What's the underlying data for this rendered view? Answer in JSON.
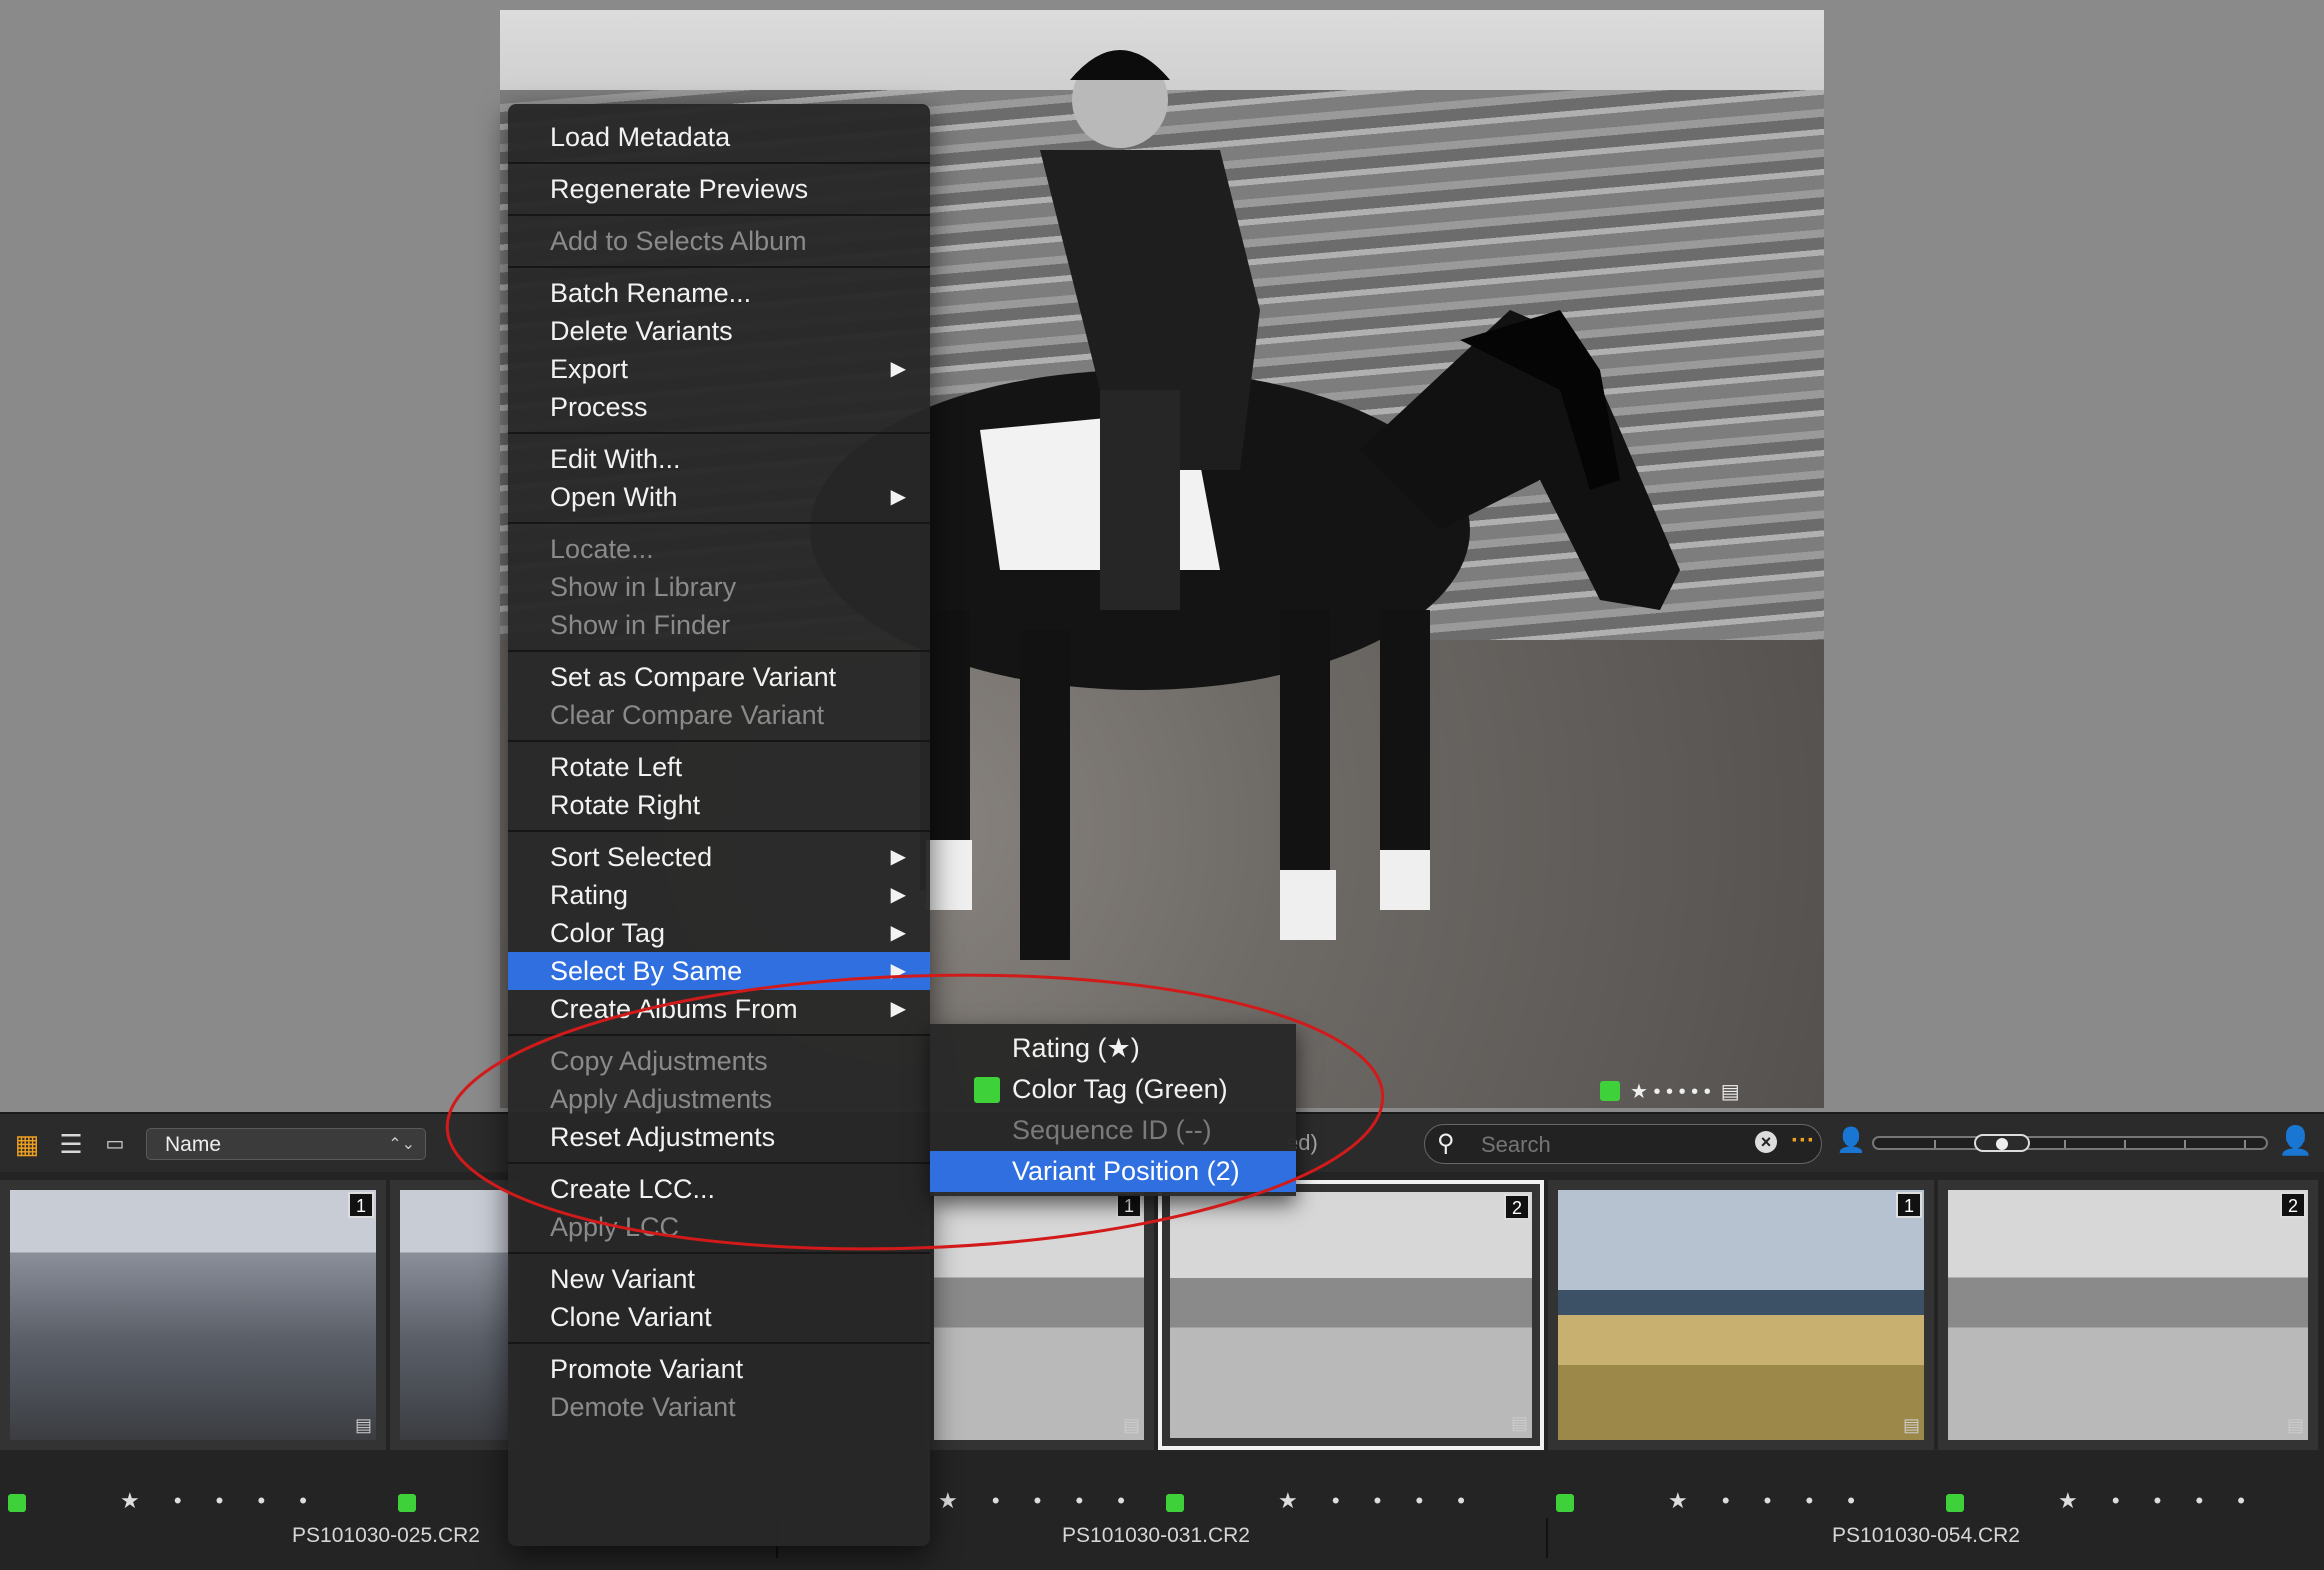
{
  "colors": {
    "accent": "#2f6fe0",
    "green_tag": "#3fd13a",
    "annotation": "#d21a1a"
  },
  "toolbar": {
    "sort_value": "Name",
    "hidden_text": "ed)",
    "search_placeholder": "Search",
    "icons": [
      "grid-view-icon",
      "list-view-icon",
      "filmstrip-view-icon",
      "sort-chevron-icon",
      "search-icon",
      "clear-search-icon",
      "more-options-icon",
      "person-small-icon",
      "person-large-icon"
    ]
  },
  "viewer": {
    "stars": "★ • • • • •"
  },
  "context_menu": {
    "groups": [
      [
        {
          "label": "Load Metadata",
          "disabled": false
        }
      ],
      [
        {
          "label": "Regenerate Previews",
          "disabled": false
        }
      ],
      [
        {
          "label": "Add to Selects Album",
          "disabled": true
        }
      ],
      [
        {
          "label": "Batch Rename...",
          "disabled": false
        },
        {
          "label": "Delete Variants",
          "disabled": false
        },
        {
          "label": "Export",
          "disabled": false,
          "submenu": true
        },
        {
          "label": "Process",
          "disabled": false
        }
      ],
      [
        {
          "label": "Edit With...",
          "disabled": false
        },
        {
          "label": "Open With",
          "disabled": false,
          "submenu": true
        }
      ],
      [
        {
          "label": "Locate...",
          "disabled": true
        },
        {
          "label": "Show in Library",
          "disabled": true
        },
        {
          "label": "Show in Finder",
          "disabled": true
        }
      ],
      [
        {
          "label": "Set as Compare Variant",
          "disabled": false
        },
        {
          "label": "Clear Compare Variant",
          "disabled": true
        }
      ],
      [
        {
          "label": "Rotate Left",
          "disabled": false
        },
        {
          "label": "Rotate Right",
          "disabled": false
        }
      ],
      [
        {
          "label": "Sort Selected",
          "disabled": false,
          "submenu": true
        },
        {
          "label": "Rating",
          "disabled": false,
          "submenu": true
        },
        {
          "label": "Color Tag",
          "disabled": false,
          "submenu": true
        },
        {
          "label": "Select By Same",
          "disabled": false,
          "submenu": true,
          "active": true
        },
        {
          "label": "Create Albums From",
          "disabled": false,
          "submenu": true
        }
      ],
      [
        {
          "label": "Copy Adjustments",
          "disabled": true
        },
        {
          "label": "Apply Adjustments",
          "disabled": true
        },
        {
          "label": "Reset Adjustments",
          "disabled": false
        }
      ],
      [
        {
          "label": "Create LCC...",
          "disabled": false
        },
        {
          "label": "Apply LCC",
          "disabled": true
        }
      ],
      [
        {
          "label": "New Variant",
          "disabled": false
        },
        {
          "label": "Clone Variant",
          "disabled": false
        }
      ],
      [
        {
          "label": "Promote Variant",
          "disabled": false
        },
        {
          "label": "Demote Variant",
          "disabled": true
        }
      ]
    ]
  },
  "submenu": {
    "items": [
      {
        "label": "Rating (★)",
        "disabled": false,
        "active": false,
        "green": false
      },
      {
        "label": "Color Tag (Green)",
        "disabled": false,
        "active": false,
        "green": true
      },
      {
        "label": "Sequence ID (--)",
        "disabled": true,
        "active": false,
        "green": false
      },
      {
        "label": "Variant Position (2)",
        "disabled": false,
        "active": true,
        "green": false
      }
    ]
  },
  "filmstrip": {
    "stars": "★ • • • •",
    "thumbs": [
      {
        "variant": "1",
        "scene": "crowd",
        "selected": false
      },
      {
        "variant": "",
        "scene": "crowd",
        "selected": false
      },
      {
        "variant": "1",
        "scene": "bw",
        "selected": false
      },
      {
        "variant": "2",
        "scene": "bw",
        "selected": true
      },
      {
        "variant": "1",
        "scene": "beach",
        "selected": false
      },
      {
        "variant": "2",
        "scene": "bw",
        "selected": false
      }
    ],
    "filenames": [
      "PS101030-025.CR2",
      "PS101030-031.CR2",
      "PS101030-054.CR2"
    ]
  }
}
